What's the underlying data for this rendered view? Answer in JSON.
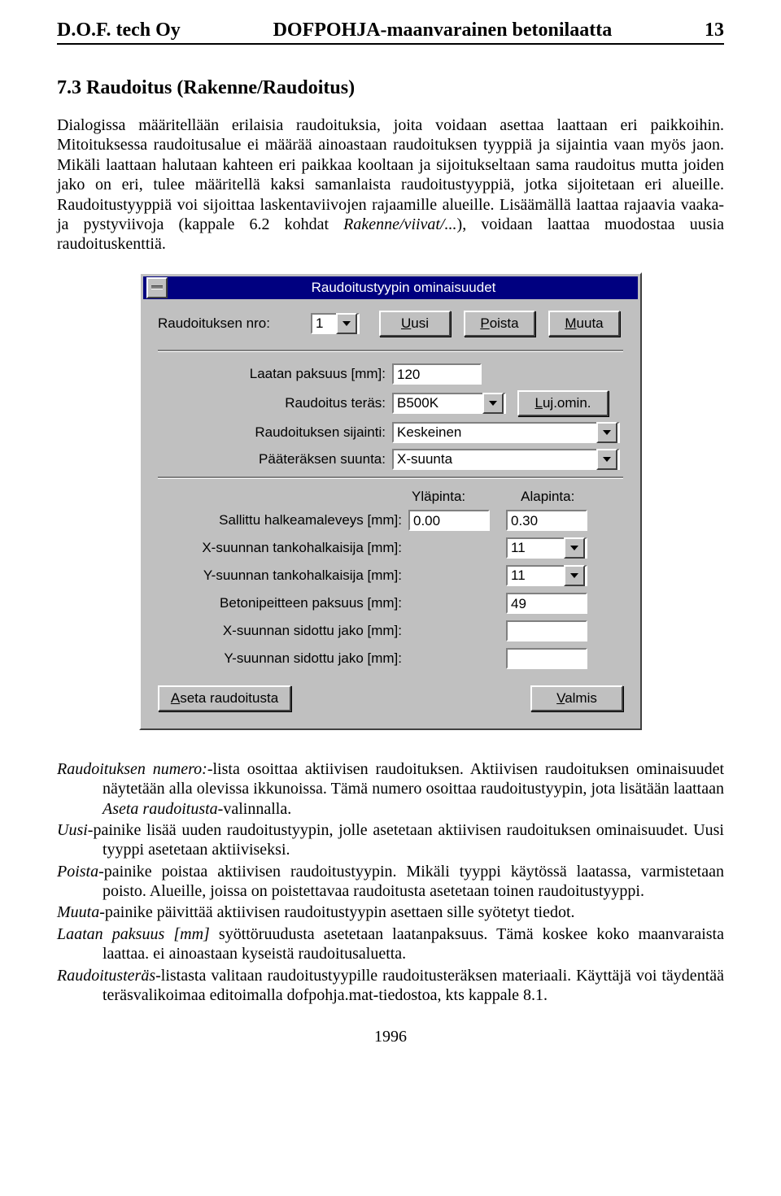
{
  "header": {
    "left": "D.O.F. tech Oy",
    "center": "DOFPOHJA-maanvarainen betonilaatta",
    "right": "13"
  },
  "section_title": "7.3 Raudoitus (Rakenne/Raudoitus)",
  "paragraphs": {
    "p1": "Dialogissa määritellään erilaisia raudoituksia, joita voidaan asettaa laattaan eri paikkoihin. Mitoituksessa raudoitusalue ei määrää ainoastaan raudoituksen tyyppiä ja sijaintia vaan myös jaon. Mikäli laattaan halutaan kahteen eri paikkaa kooltaan ja sijoitukseltaan sama raudoitus mutta joiden jako on eri, tulee määritellä kaksi samanlaista raudoitustyyppiä, jotka sijoitetaan eri alueille. Raudoitustyyppiä voi sijoittaa laskentaviivojen rajaamille alueille. Lisäämällä laattaa rajaavia vaaka- ja pystyviivoja (kappale 6.2 kohdat ",
    "p1_italic": "Rakenne/viivat/...",
    "p1_end": "), voidaan laattaa muodostaa uusia raudoituskenttiä."
  },
  "dialog": {
    "title": "Raudoitustyypin ominaisuudet",
    "row1_label": "Raudoituksen nro:",
    "nro_value": "1",
    "btn_uusi": "Uusi",
    "btn_poista": "Poista",
    "btn_muuta": "Muuta",
    "r_paksuus_label": "Laatan paksuus [mm]:",
    "r_paksuus_value": "120",
    "r_teras_label": "Raudoitus teräs:",
    "r_teras_value": "B500K",
    "btn_lujomin": "Luj.omin.",
    "r_sijainti_label": "Raudoituksen sijainti:",
    "r_sijainti_value": "Keskeinen",
    "r_suunta_label": "Pääteräksen suunta:",
    "r_suunta_value": "X-suunta",
    "hdr_yla": "Yläpinta:",
    "hdr_ala": "Alapinta:",
    "r_halk_label": "Sallittu halkeamaleveys [mm]:",
    "r_halk_yla": "0.00",
    "r_halk_ala": "0.30",
    "r_xtk_label": "X-suunnan tankohalkaisija [mm]:",
    "r_xtk_value": "11",
    "r_ytk_label": "Y-suunnan tankohalkaisija [mm]:",
    "r_ytk_value": "11",
    "r_bp_label": "Betonipeitteen paksuus [mm]:",
    "r_bp_value": "49",
    "r_xsj_label": "X-suunnan sidottu jako [mm]:",
    "r_ysj_label": "Y-suunnan sidottu jako [mm]:",
    "btn_aseta": "Aseta raudoitusta",
    "btn_valmis": "Valmis"
  },
  "defs": {
    "d1a": "Raudoituksen numero:",
    "d1b": "-lista osoittaa aktiivisen raudoituksen. Aktiivisen raudoituksen ominaisuudet näytetään alla olevissa ikkunoissa. Tämä numero osoittaa raudoitustyypin, jota lisätään laattaan ",
    "d1c": "Aseta raudoitusta",
    "d1d": "-valinnalla.",
    "d2a": "Uusi",
    "d2b": "-painike lisää uuden raudoitustyypin, jolle asetetaan aktiivisen raudoituksen ominaisuudet. Uusi tyyppi asetetaan aktiiviseksi.",
    "d3a": "Poista",
    "d3b": "-painike poistaa aktiivisen raudoitustyypin. Mikäli tyyppi käytössä laatassa, varmistetaan poisto. Alueille, joissa on poistettavaa raudoitusta asetetaan toinen raudoitustyyppi.",
    "d4a": "Muuta",
    "d4b": "-painike päivittää aktiivisen raudoitustyypin asettaen sille syötetyt tiedot.",
    "d5a": "Laatan paksuus [mm]",
    "d5b": " syöttöruudusta asetetaan laatanpaksuus. Tämä koskee koko maanvaraista laattaa. ei ainoastaan kyseistä raudoitusaluetta.",
    "d6a": "Raudoitusteräs",
    "d6b": "-listasta valitaan raudoitustyypille raudoitusteräksen materiaali. Käyttäjä voi täydentää teräsvalikoimaa editoimalla dofpohja.mat-tiedostoa, kts kappale 8.1."
  },
  "footer_year": "1996"
}
